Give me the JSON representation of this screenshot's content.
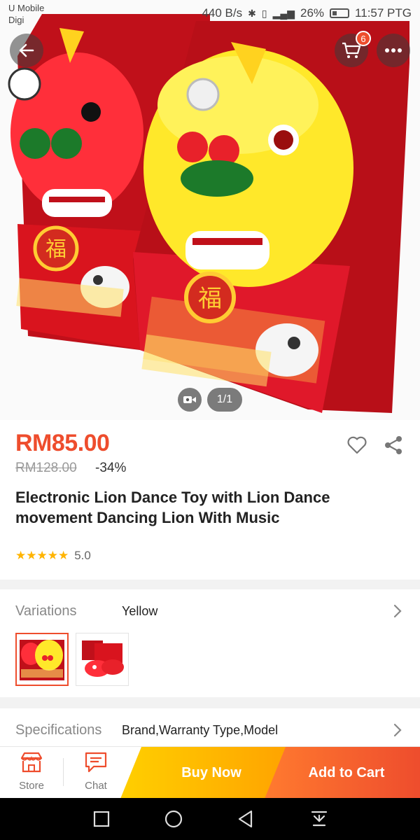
{
  "status_bar": {
    "carrier_line1": "U Mobile",
    "carrier_line2": "Digi",
    "net_speed": "440 B/s",
    "battery": "26%",
    "time": "11:57 PTG"
  },
  "header": {
    "cart_count": "6"
  },
  "gallery": {
    "counter": "1/1"
  },
  "product": {
    "price": "RM85.00",
    "original_price": "RM128.00",
    "discount": "-34%",
    "title": "Electronic Lion Dance Toy with Lion Dance movement Dancing Lion With Music",
    "rating_value": "5.0",
    "stars": 5
  },
  "variations": {
    "label": "Variations",
    "selected": "Yellow",
    "options_count": 2
  },
  "specifications": {
    "label": "Specifications",
    "summary": "Brand,Warranty Type,Model"
  },
  "action_bar": {
    "store_label": "Store",
    "chat_label": "Chat",
    "buy_now_label": "Buy Now",
    "add_to_cart_label": "Add to Cart"
  },
  "colors": {
    "accent": "#ee4d2d",
    "buy_now_start": "#ffcf00",
    "buy_now_end": "#ffa300",
    "star": "#ffb400"
  }
}
